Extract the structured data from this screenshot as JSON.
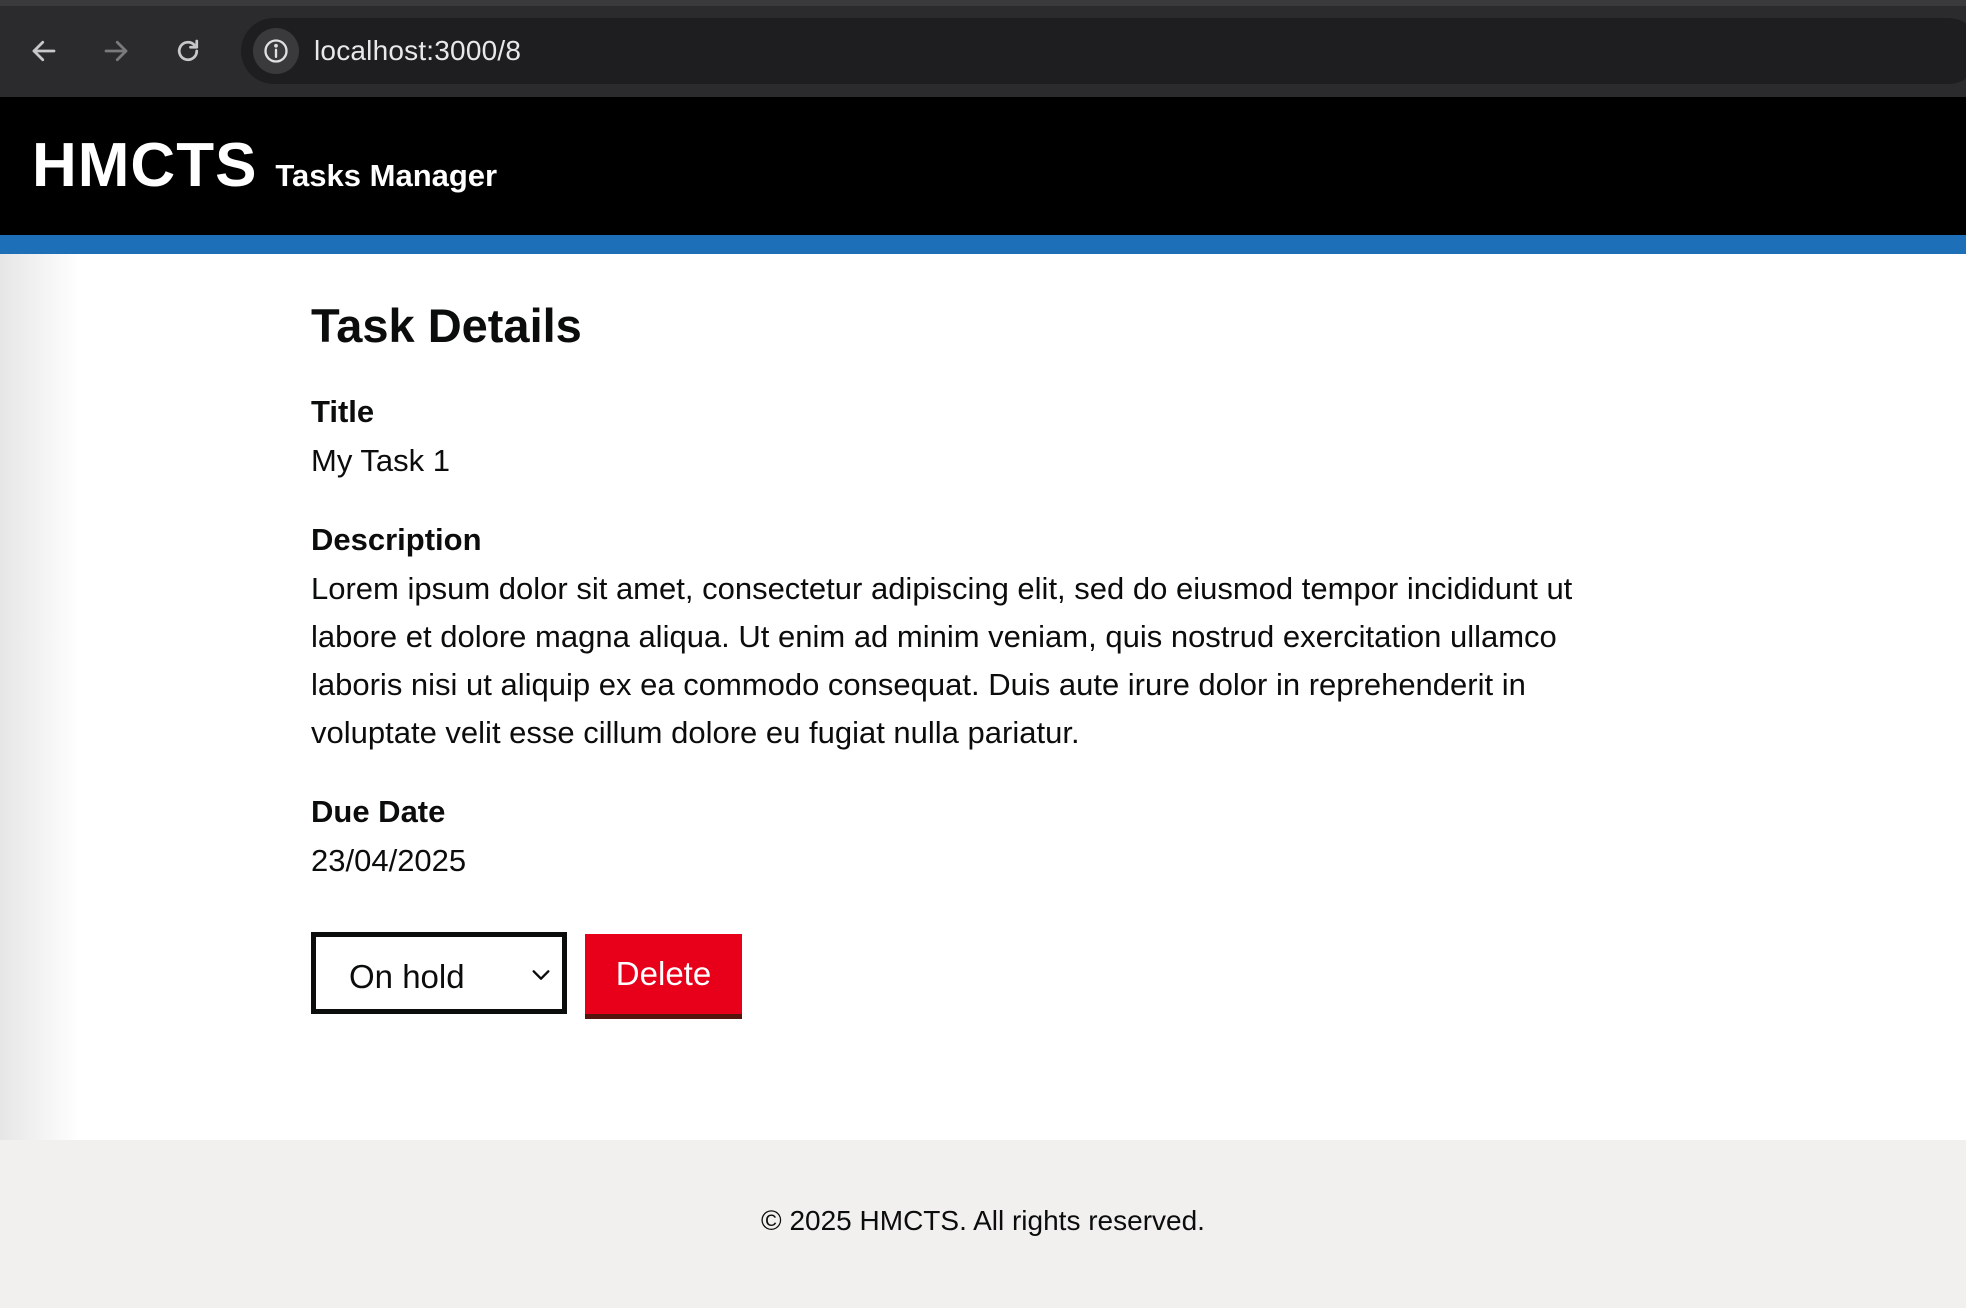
{
  "browser": {
    "url": "localhost:3000/8",
    "back_icon": "arrow-left-icon",
    "forward_icon": "arrow-right-icon",
    "reload_icon": "reload-icon",
    "site_info_icon": "info-icon"
  },
  "header": {
    "brand": "HMCTS",
    "service_name": "Tasks Manager",
    "accent_color": "#1d70b8"
  },
  "task": {
    "page_title": "Task Details",
    "title_label": "Title",
    "title_value": "My Task 1",
    "description_label": "Description",
    "description_value": "Lorem ipsum dolor sit amet, consectetur adipiscing elit, sed do eiusmod tempor incididunt ut labore et dolore magna aliqua. Ut enim ad minim veniam, quis nostrud exercitation ullamco laboris nisi ut aliquip ex ea commodo consequat. Duis aute irure dolor in reprehenderit in voluptate velit esse cillum dolore eu fugiat nulla pariatur.",
    "due_date_label": "Due Date",
    "due_date_value": "23/04/2025"
  },
  "actions": {
    "status_selected": "On hold",
    "delete_label": "Delete",
    "delete_color": "#e8001a"
  },
  "footer": {
    "text": "© 2025 HMCTS. All rights reserved."
  }
}
